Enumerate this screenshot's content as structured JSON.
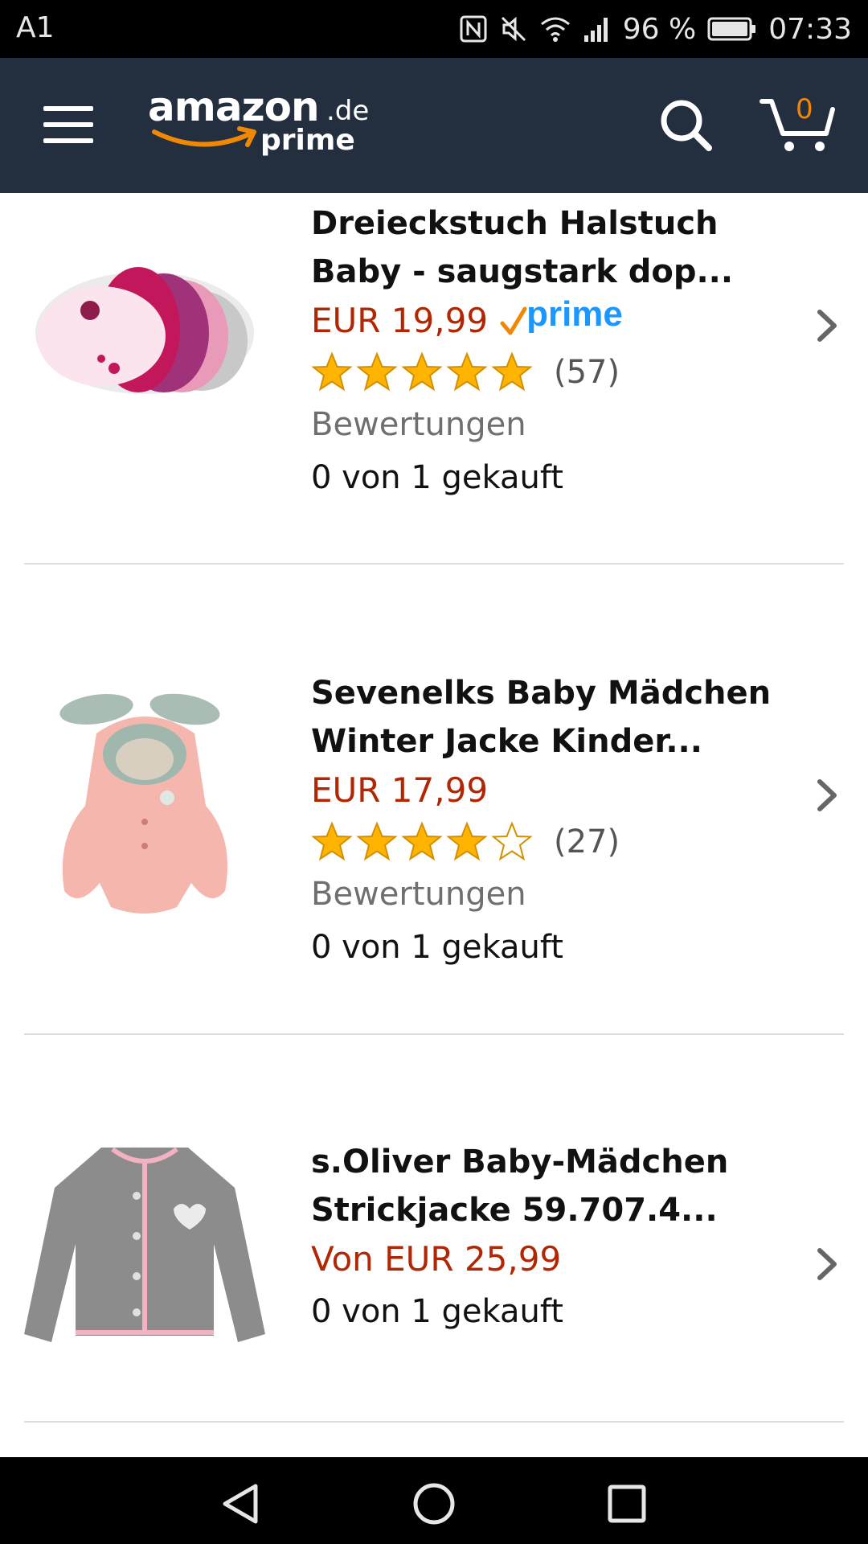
{
  "status_bar": {
    "carrier": "A1",
    "battery": "96 %",
    "time": "07:33",
    "icons": [
      "nfc-icon",
      "mute-icon",
      "wifi-icon",
      "signal-icon",
      "battery-icon"
    ]
  },
  "header": {
    "logo_word": "amazon",
    "logo_tld": ".de",
    "logo_sub": "prime",
    "cart_count": "0",
    "colors": {
      "bar": "#232f3e",
      "accent": "#f08804",
      "price": "#b12704",
      "prime_blue": "#1a98ff"
    }
  },
  "products": [
    {
      "title": "Dreieckstuch Halstuch Baby - saugstark dop...",
      "price": "EUR 19,99",
      "prime": true,
      "prime_label": "prime",
      "rating": 5,
      "rating_count": "(57)",
      "reviews_label": "Bewertungen",
      "bought": "0 von 1 gekauft"
    },
    {
      "title": "Sevenelks Baby Mädchen Winter Jacke Kinder...",
      "price": "EUR 17,99",
      "prime": false,
      "rating": 4,
      "rating_count": "(27)",
      "reviews_label": "Bewertungen",
      "bought": "0 von 1 gekauft"
    },
    {
      "title": "s.Oliver Baby-Mädchen Strickjacke 59.707.4...",
      "price": "Von EUR 25,99",
      "prime": false,
      "bought": "0 von 1 gekauft"
    }
  ]
}
